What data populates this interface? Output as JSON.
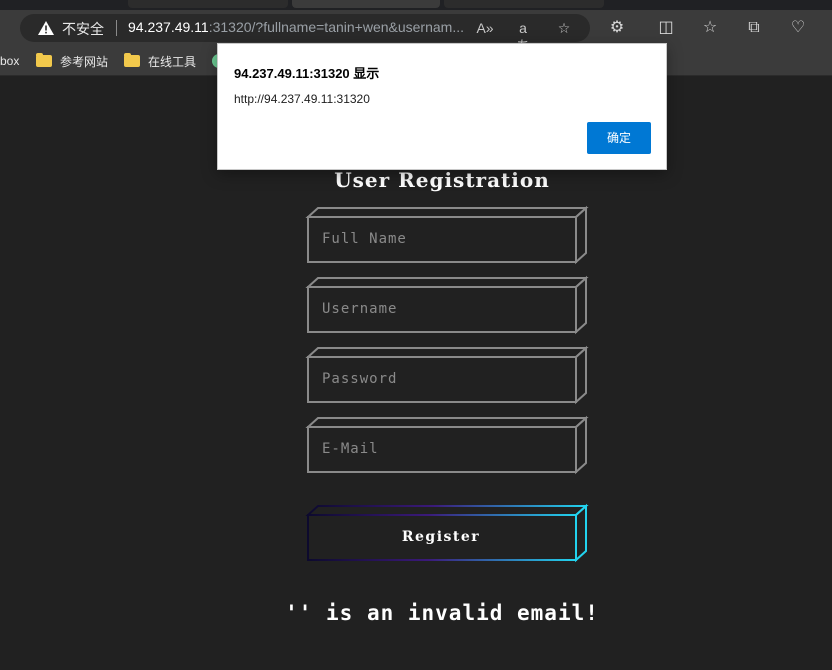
{
  "browser": {
    "security_label": "不安全",
    "url_host": "94.237.49.11",
    "url_rest": ":31320/?fullname=tanin+wen&usernam...",
    "bookmarks": [
      {
        "label": "box"
      },
      {
        "label": "参考网站"
      },
      {
        "label": "在线工具"
      }
    ]
  },
  "form": {
    "title": "User Registration",
    "fields": [
      {
        "placeholder": "Full Name"
      },
      {
        "placeholder": "Username"
      },
      {
        "placeholder": "Password"
      },
      {
        "placeholder": "E-Mail"
      }
    ],
    "submit_label": "Register",
    "message": "'' is an invalid email!"
  },
  "dialog": {
    "title": "94.237.49.11:31320 显示",
    "message": "http://94.237.49.11:31320",
    "ok_label": "确定"
  },
  "colors": {
    "page_bg": "#212121",
    "field_stroke": "#8a8a8a",
    "button_gradient_start": "#1a0a3a",
    "button_gradient_end": "#22d3ee",
    "dialog_button": "#0078d4"
  }
}
